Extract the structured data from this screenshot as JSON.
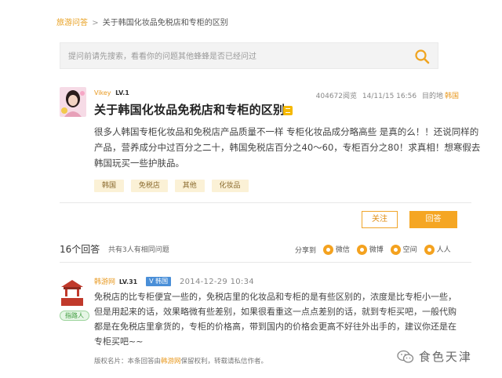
{
  "breadcrumb": {
    "home": "旅游问答",
    "separator": ">",
    "current": "关于韩国化妆品免税店和专柜的区别"
  },
  "search": {
    "placeholder": "提问前请先搜索，看看你的问题其他蜂蜂是否已经问过"
  },
  "question": {
    "user": "Vikey",
    "level": "LV.1",
    "views": "404672阅览",
    "date": "14/11/15 16:56",
    "destination_label": "目的地",
    "destination": "韩国",
    "title": "关于韩国化妆品免税店和专柜的区别",
    "body_lines": [
      "很多人韩国专柜化妆品和免税店产品质量不一样 专柜化妆品成分略高些 是真的么！！还说同样的",
      "产品，营养成分中过百分之二十，韩国免税店百分之40～60，专柜百分之80！求真相！想寒假去",
      "韩国玩买一些护肤品。"
    ],
    "tags": [
      "韩国",
      "免税店",
      "其他",
      "化妆品"
    ]
  },
  "actions": {
    "follow": "关注",
    "answer": "回答"
  },
  "answers_bar": {
    "count": "16个回答",
    "same_question": "共有3人有相同问题",
    "share_label": "分享到",
    "share_targets": [
      "微信",
      "微博",
      "空间",
      "人人"
    ]
  },
  "answer": {
    "user": "韩游网",
    "level": "LV.31",
    "location": "V 韩国",
    "time": "2014-12-29 10:34",
    "badge": "指路人",
    "body_lines": [
      "免税店的比专柜便宜一些的，免税店里的化妆品和专柜的是有些区别的，浓度是比专柜小一些，",
      "但是用起来的话，效果略微有些差别，如果很看重这一点点差别的话，就到专柜买吧，一般代购",
      "都是在免税店里拿货的，专柜的价格高，带到国内的价格会更高不好往外出手的，建议你还是在",
      "专柜买吧~~"
    ],
    "copyright_prefix": "版权名片：本条回答由",
    "copyright_brand": "韩游网",
    "copyright_suffix": "保留权利，转载请私信作者。"
  },
  "watermark": {
    "text": "食色天津"
  },
  "colors": {
    "accent": "#f5a623",
    "link_orange": "#e89a22",
    "tag_bg": "#fbf1d6",
    "location_badge": "#4a8fd8"
  }
}
